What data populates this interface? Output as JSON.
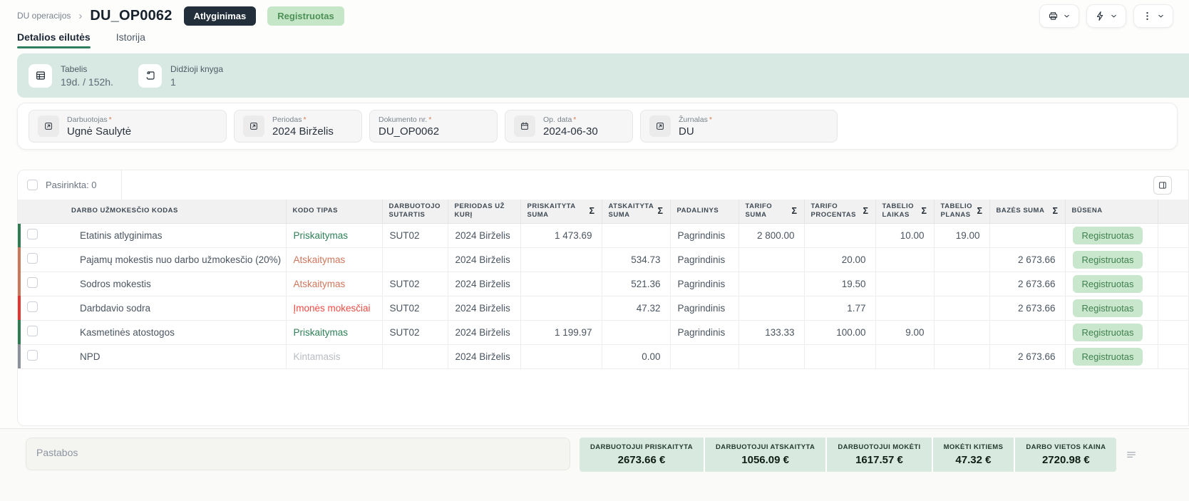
{
  "page": {
    "breadcrumb_parent": "DU operacijos",
    "title": "DU_OP0062",
    "type_badge": "Atlyginimas",
    "status_badge": "Registruotas"
  },
  "colors": {
    "accent_green": "#2F7E5C",
    "badge_dark_bg": "#232E3B",
    "status_green_bg": "#C8E7CD",
    "status_green_text": "#41804F",
    "banner_bg": "#D7E9E2",
    "summary_bg": "#D8EADF"
  },
  "topbar_actions": [
    {
      "icon": "printer-icon"
    },
    {
      "icon": "lightning-icon"
    },
    {
      "icon": "kebab-icon"
    }
  ],
  "tabs": [
    {
      "label": "Detalios eilutės",
      "active": true
    },
    {
      "label": "Istorija",
      "active": false
    }
  ],
  "info_cards": [
    {
      "icon": "timesheet-icon",
      "label": "Tabelis",
      "value": "19d. / 152h."
    },
    {
      "icon": "ledger-icon",
      "label": "Didžioji knyga",
      "value": "1"
    }
  ],
  "fields": [
    {
      "icon": "external-link-icon",
      "label": "Darbuotojas",
      "required": "*",
      "value": "Ugnė Saulytė"
    },
    {
      "icon": "external-link-icon",
      "label": "Periodas",
      "required": "*",
      "value": "2024 Birželis"
    },
    {
      "icon": null,
      "label": "Dokumento nr.",
      "required": "*",
      "value": "DU_OP0062"
    },
    {
      "icon": "calendar-icon",
      "label": "Op. data",
      "required": "*",
      "value": "2024-06-30"
    },
    {
      "icon": "external-link-icon",
      "label": "Žurnalas",
      "required": "*",
      "value": "DU"
    }
  ],
  "table": {
    "selected_label": "Pasirinkta: 0",
    "columns": [
      {
        "lines": [
          "DARBO UŽMOKESČIO KODAS"
        ],
        "sigma": false
      },
      {
        "lines": [
          "KODO TIPAS"
        ],
        "sigma": false
      },
      {
        "lines": [
          "DARBUOTOJO",
          "SUTARTIS"
        ],
        "sigma": false
      },
      {
        "lines": [
          "PERIODAS UŽ",
          "KURĮ"
        ],
        "sigma": false
      },
      {
        "lines": [
          "PRISKAITYTA",
          "SUMA"
        ],
        "sigma": true
      },
      {
        "lines": [
          "ATSKAITYTA",
          "SUMA"
        ],
        "sigma": true
      },
      {
        "lines": [
          "PADALINYS"
        ],
        "sigma": false
      },
      {
        "lines": [
          "TARIFO",
          "SUMA"
        ],
        "sigma": true
      },
      {
        "lines": [
          "TARIFO",
          "PROCENTAS"
        ],
        "sigma": true
      },
      {
        "lines": [
          "TABELIO",
          "LAIKAS"
        ],
        "sigma": true
      },
      {
        "lines": [
          "TABELIO",
          "PLANAS"
        ],
        "sigma": true
      },
      {
        "lines": [
          "BAZĖS SUMA"
        ],
        "sigma": true
      },
      {
        "lines": [
          "BŪSENA"
        ],
        "sigma": false
      }
    ],
    "rows": [
      {
        "bar_color": "#2E7D52",
        "tipas_color": "#2E8057",
        "status": "Registruotas",
        "cells": [
          "Etatinis atlyginimas",
          "Priskaitymas",
          "SUT02",
          "2024 Birželis",
          "1 473.69",
          "",
          "Pagrindinis",
          "2 800.00",
          "",
          "10.00",
          "19.00",
          ""
        ]
      },
      {
        "bar_color": "#C9795A",
        "tipas_color": "#D1765B",
        "status": "Registruotas",
        "cells": [
          "Pajamų mokestis nuo darbo užmokesčio (20%)",
          "Atskaitymas",
          "",
          "2024 Birželis",
          "",
          "534.73",
          "Pagrindinis",
          "",
          "20.00",
          "",
          "",
          "2 673.66"
        ]
      },
      {
        "bar_color": "#C9795A",
        "tipas_color": "#D1765B",
        "status": "Registruotas",
        "cells": [
          "Sodros mokestis",
          "Atskaitymas",
          "SUT02",
          "2024 Birželis",
          "",
          "521.36",
          "Pagrindinis",
          "",
          "19.50",
          "",
          "",
          "2 673.66"
        ]
      },
      {
        "bar_color": "#E5332D",
        "tipas_color": "#EF4B43",
        "status": "Registruotas",
        "cells": [
          "Darbdavio sodra",
          "Įmonės mokesčiai",
          "SUT02",
          "2024 Birželis",
          "",
          "47.32",
          "Pagrindinis",
          "",
          "1.77",
          "",
          "",
          "2 673.66"
        ]
      },
      {
        "bar_color": "#2E7D52",
        "tipas_color": "#2E8057",
        "status": "Registruotas",
        "cells": [
          "Kasmetinės atostogos",
          "Priskaitymas",
          "SUT02",
          "2024 Birželis",
          "1 199.97",
          "",
          "Pagrindinis",
          "133.33",
          "100.00",
          "9.00",
          "",
          ""
        ]
      },
      {
        "bar_color": "#8B929B",
        "tipas_color": "#B7BDC3",
        "status": "Registruotas",
        "cells": [
          "NPD",
          "Kintamasis",
          "",
          "2024 Birželis",
          "",
          "0.00",
          "",
          "",
          "",
          "",
          "",
          "2 673.66"
        ]
      }
    ]
  },
  "footer": {
    "notes_placeholder": "Pastabos",
    "summary": [
      {
        "label": "DARBUOTOJUI PRISKAITYTA",
        "value": "2673.66 €"
      },
      {
        "label": "DARBUOTOJUI ATSKAITYTA",
        "value": "1056.09 €"
      },
      {
        "label": "DARBUOTOJUI MOKĖTI",
        "value": "1617.57 €"
      },
      {
        "label": "MOKĖTI KITIEMS",
        "value": "47.32 €"
      },
      {
        "label": "DARBO VIETOS KAINA",
        "value": "2720.98 €"
      }
    ]
  }
}
